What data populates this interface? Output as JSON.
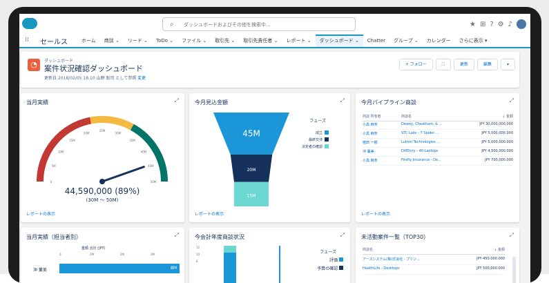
{
  "search": {
    "placeholder": "ダッシュボードおよびその他を検索中..."
  },
  "nav": {
    "app_name": "セールス",
    "items": [
      {
        "label": "ホーム",
        "chevron": ""
      },
      {
        "label": "商談",
        "chevron": "⌄"
      },
      {
        "label": "リード",
        "chevron": "⌄"
      },
      {
        "label": "ToDo",
        "chevron": "⌄"
      },
      {
        "label": "ファイル",
        "chevron": "⌄"
      },
      {
        "label": "取引先",
        "chevron": "⌄"
      },
      {
        "label": "取引先責任者",
        "chevron": "⌄"
      },
      {
        "label": "レポート",
        "chevron": "⌄"
      },
      {
        "label": "ダッシュボード",
        "chevron": "⌄"
      },
      {
        "label": "Chatter",
        "chevron": ""
      },
      {
        "label": "グループ",
        "chevron": "⌄"
      },
      {
        "label": "カレンダー",
        "chevron": ""
      },
      {
        "label": "さらに表示",
        "chevron": "▾"
      }
    ]
  },
  "header": {
    "type_label": "ダッシュボード",
    "title": "案件状況確認ダッシュボード",
    "meta": "更新日 2018/02/05 18:10 山野 聡司 として参照",
    "meta_link": "変更",
    "follow_label": "+ フォロー",
    "refresh_label": "更新",
    "edit_label": "編集"
  },
  "cards": {
    "gauge": {
      "title": "当月実績",
      "value_text": "44,590,000 (89%)",
      "range_text": "(30M ～ 50M)",
      "tick_labels": [
        "0",
        "5M",
        "10M",
        "15M",
        "20M",
        "25M",
        "30M",
        "35M",
        "40M",
        "45M",
        "50M"
      ],
      "report_link": "レポートの表示"
    },
    "funnel": {
      "title": "今月見込金額",
      "legend_title": "フェーズ",
      "stages": [
        {
          "label": "成立",
          "value_text": "45M",
          "color": "#1b96d9"
        },
        {
          "label": "最終交渉",
          "value_text": "20M",
          "color": "#16325c"
        },
        {
          "label": "決定者の確認",
          "value_text": "15M",
          "color": "#6bd7d1"
        }
      ],
      "report_link": "レポートの表示"
    },
    "pipeline": {
      "title": "今月パイプライン商談",
      "columns": [
        "商談 所有者",
        "商談名",
        "金額"
      ],
      "rows": [
        {
          "owner": "小黒 麻奈",
          "name": "Dewey, Cheatham, & ...",
          "amount": "JPY 30,000,000.000"
        },
        {
          "owner": "小黒 麻奈",
          "name": "STC Labs - 7 Spider ...",
          "amount": "JPY 5,000,000.000"
        },
        {
          "owner": "植田 一樹",
          "name": "Lutron Technologies ...",
          "amount": "JPY 5,000,000.000"
        },
        {
          "owner": "沖 薫美",
          "name": "DiffDory - 40 Laptops",
          "amount": "JPY 4,500,000.000"
        },
        {
          "owner": "小黒 麻奈",
          "name": "Firefly Insurance - De...",
          "amount": "JPY 700,000.000"
        }
      ],
      "report_link": "レポートの表示"
    },
    "by_owner": {
      "title": "当月実績（担当者別）",
      "axis_label": "金額 合計 (JPY)",
      "first_row_label": "沖 薫美",
      "first_row_value": "8M"
    },
    "year": {
      "title": "今会計年度商談状況",
      "legend_title": "フェーズ",
      "legend": [
        {
          "label": "評価",
          "color": "#1b96d9"
        },
        {
          "label": "予算の確認",
          "color": "#16325c"
        }
      ]
    },
    "inactive": {
      "title": "未活動案件一覧（TOP30）",
      "columns": [
        "商談名",
        "金額"
      ],
      "rows": [
        {
          "name": "アースシステム(株)式会社 - プリン...",
          "amount": "JPY 450,000.000"
        },
        {
          "name": "HealthLife - Desktops",
          "amount": "JPY 500,000.000"
        }
      ]
    }
  },
  "chart_data": [
    {
      "type": "gauge",
      "title": "当月実績",
      "value": 44590000,
      "percent": 89,
      "range": [
        30000000,
        50000000
      ],
      "scale": [
        0,
        50000000
      ],
      "bands": [
        {
          "from": 0,
          "to": 22000000,
          "color": "#c23934"
        },
        {
          "from": 22000000,
          "to": 33000000,
          "color": "#f4b942"
        },
        {
          "from": 33000000,
          "to": 50000000,
          "color": "#007467"
        }
      ]
    },
    {
      "type": "funnel",
      "title": "今月見込金額",
      "categories": [
        "成立",
        "最終交渉",
        "決定者の確認"
      ],
      "values": [
        45,
        20,
        15
      ]
    }
  ]
}
